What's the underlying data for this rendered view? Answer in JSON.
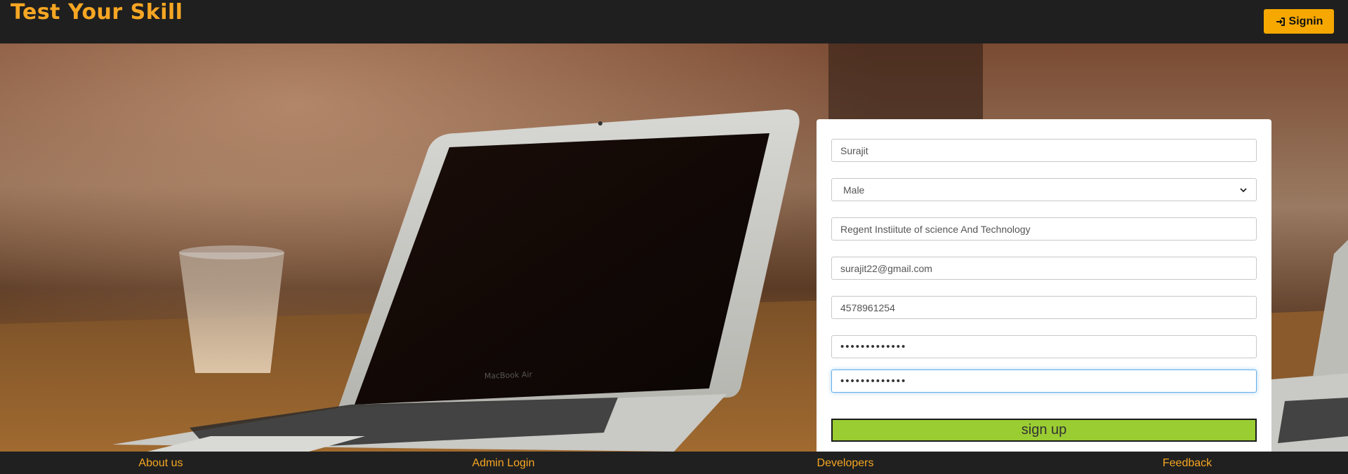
{
  "header": {
    "brand": "Test Your Skill",
    "signin_label": "Signin",
    "signin_icon": "sign-in-icon",
    "accent_color": "#f6a623"
  },
  "form": {
    "name_value": "Surajit",
    "gender_value": "Male",
    "institute_value": "Regent Instiitute of science And Technology",
    "email_value": "surajit22@gmail.com",
    "phone_value": "4578961254",
    "password_value": "•••••••••••••",
    "confirm_password_value": "•••••••••••••",
    "submit_label": "sign up",
    "submit_color": "#9acd32"
  },
  "footer": {
    "links": [
      "About us",
      "Admin Login",
      "Developers",
      "Feedback"
    ]
  }
}
